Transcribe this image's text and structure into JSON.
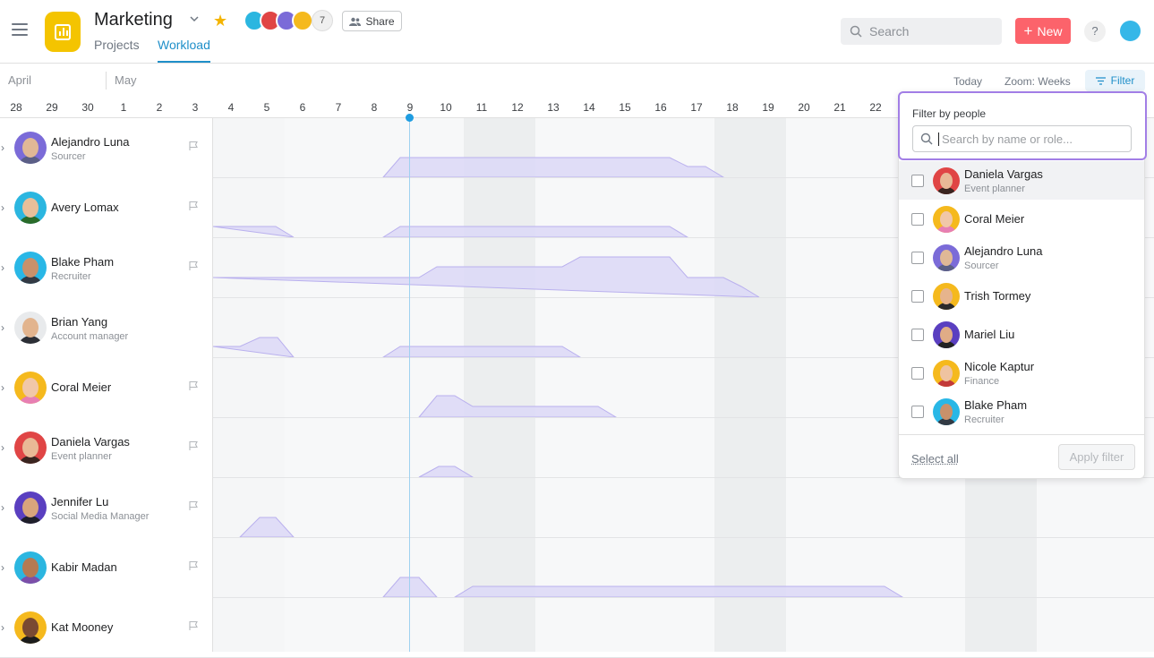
{
  "header": {
    "project_title": "Marketing",
    "tabs": [
      {
        "label": "Projects",
        "active": false
      },
      {
        "label": "Workload",
        "active": true
      }
    ],
    "member_count": "7",
    "share_label": "Share",
    "search_placeholder": "Search",
    "new_label": "New",
    "help_label": "?"
  },
  "timeline": {
    "months": [
      "April",
      "May"
    ],
    "days": [
      "28",
      "29",
      "30",
      "1",
      "2",
      "3",
      "4",
      "5",
      "6",
      "7",
      "8",
      "9",
      "10",
      "11",
      "12",
      "13",
      "14",
      "15",
      "16",
      "17",
      "18",
      "19",
      "20",
      "21",
      "22"
    ],
    "today_label": "Today",
    "zoom_label": "Zoom: Weeks",
    "filter_label": "Filter"
  },
  "people": [
    {
      "name": "Alejandro Luna",
      "role": "Sourcer",
      "color": "#7b6bd8",
      "skin": "#e0b896",
      "shirt": "#5b5f86",
      "flag": true
    },
    {
      "name": "Avery Lomax",
      "role": "",
      "color": "#2bb6e0",
      "skin": "#e8bf9a",
      "shirt": "#2a6b2a",
      "flag": true
    },
    {
      "name": "Blake Pham",
      "role": "Recruiter",
      "color": "#29b7e6",
      "skin": "#c9916b",
      "shirt": "#333a44",
      "flag": true
    },
    {
      "name": "Brian Yang",
      "role": "Account manager",
      "color": "#e8eaec",
      "skin": "#e2b48e",
      "shirt": "#2c2f36",
      "flag": false
    },
    {
      "name": "Coral Meier",
      "role": "",
      "color": "#f5b91d",
      "skin": "#f1c7a8",
      "shirt": "#e77fb3",
      "flag": true
    },
    {
      "name": "Daniela Vargas",
      "role": "Event planner",
      "color": "#e04545",
      "skin": "#e9b996",
      "shirt": "#3a2520",
      "flag": true
    },
    {
      "name": "Jennifer Lu",
      "role": "Social Media Manager",
      "color": "#5a3fc0",
      "skin": "#d9a57c",
      "shirt": "#1f1f2a",
      "flag": true
    },
    {
      "name": "Kabir Madan",
      "role": "",
      "color": "#2bb6e0",
      "skin": "#b57a52",
      "shirt": "#7c4fa8",
      "flag": true
    },
    {
      "name": "Kat Mooney",
      "role": "",
      "color": "#f5b91d",
      "skin": "#7a4a32",
      "shirt": "#1c1c1c",
      "flag": true
    }
  ],
  "filter_popover": {
    "label": "Filter by people",
    "search_placeholder": "Search by name or role...",
    "options": [
      {
        "name": "Daniela Vargas",
        "role": "Event planner",
        "color": "#e04545",
        "skin": "#e9b996",
        "shirt": "#3a2520",
        "highlighted": true
      },
      {
        "name": "Coral Meier",
        "role": "",
        "color": "#f5b91d",
        "skin": "#f1c7a8",
        "shirt": "#e77fb3",
        "highlighted": false
      },
      {
        "name": "Alejandro Luna",
        "role": "Sourcer",
        "color": "#7b6bd8",
        "skin": "#e0b896",
        "shirt": "#5b5f86",
        "highlighted": false
      },
      {
        "name": "Trish Tormey",
        "role": "",
        "color": "#f5b91d",
        "skin": "#e6b48d",
        "shirt": "#2b2b2b",
        "highlighted": false
      },
      {
        "name": "Mariel Liu",
        "role": "",
        "color": "#5a3fc0",
        "skin": "#e0ac86",
        "shirt": "#222",
        "highlighted": false
      },
      {
        "name": "Nicole Kaptur",
        "role": "Finance",
        "color": "#f5b91d",
        "skin": "#efc3a0",
        "shirt": "#c23a3a",
        "highlighted": false
      },
      {
        "name": "Blake Pham",
        "role": "Recruiter",
        "color": "#29b7e6",
        "skin": "#c9916b",
        "shirt": "#333a44",
        "highlighted": false
      }
    ],
    "select_all_label": "Select all",
    "apply_label": "Apply filter"
  },
  "colors": {
    "accent": "#1f8fc9",
    "new_button": "#fc636b",
    "workload_fill": "#dcd8f7",
    "workload_stroke": "#b9b0ee",
    "popover_focus": "#a27ee6"
  }
}
